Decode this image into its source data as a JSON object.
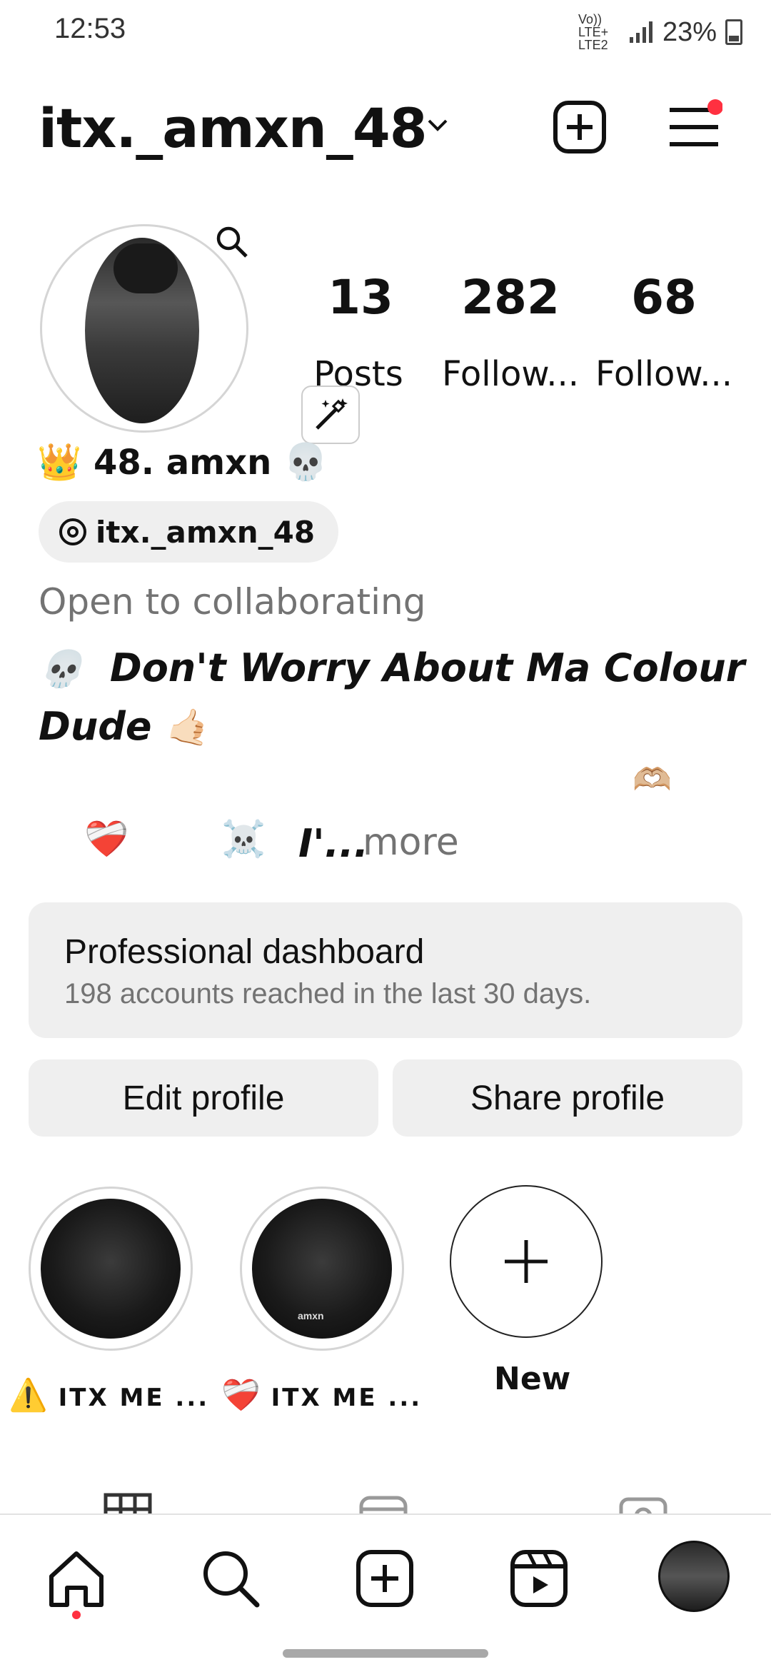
{
  "status": {
    "time": "12:53",
    "network": "Vo)) LTE+ LTE2",
    "battery": "23%"
  },
  "header": {
    "username": "itx._amxn_48"
  },
  "profile": {
    "stats": [
      {
        "value": "13",
        "label": "Posts"
      },
      {
        "value": "282",
        "label": "Follow..."
      },
      {
        "value": "68",
        "label": "Follow..."
      }
    ],
    "name": "48. amxn",
    "threads_handle": "itx._amxn_48",
    "category": "Open to collaborating",
    "bio_line1": "Don't Worry About Ma Colour",
    "bio_line2": "Dude",
    "bio_line3": "I'...",
    "more": "more"
  },
  "dashboard": {
    "title": "Professional dashboard",
    "subtitle": "198 accounts reached in the last 30 days."
  },
  "buttons": {
    "edit": "Edit profile",
    "share": "Share profile"
  },
  "highlights": [
    {
      "label": "ITX ME ..."
    },
    {
      "label": "ITX ME ...",
      "overlay": "amxn"
    }
  ],
  "new_highlight": "New",
  "colors": {
    "accent_dot": "#ff3040",
    "button_bg": "#efefef",
    "muted_text": "#737373"
  },
  "icons": [
    "new-post-icon",
    "menu-icon",
    "search-icon",
    "magic-wand-icon",
    "threads-icon",
    "home-icon",
    "explore-icon",
    "create-icon",
    "reels-icon",
    "profile-avatar-icon"
  ]
}
